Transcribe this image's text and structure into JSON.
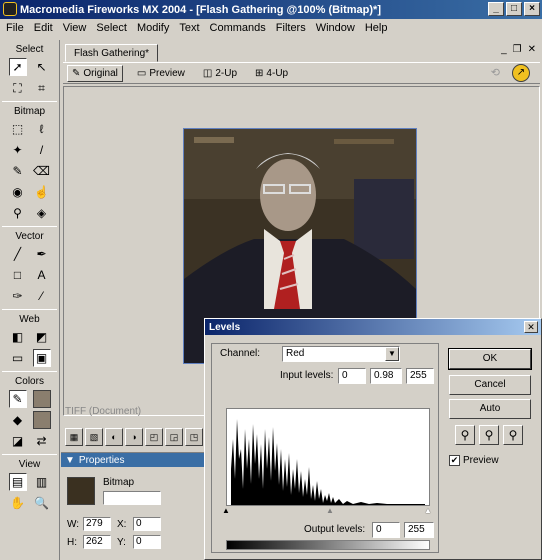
{
  "window": {
    "title": "Macromedia Fireworks MX 2004 - [Flash Gathering @100% (Bitmap)*]",
    "min": "_",
    "max": "□",
    "close": "×"
  },
  "menu": [
    "File",
    "Edit",
    "View",
    "Select",
    "Modify",
    "Text",
    "Commands",
    "Filters",
    "Window",
    "Help"
  ],
  "toolbox": {
    "select": "Select",
    "bitmap": "Bitmap",
    "vector": "Vector",
    "web": "Web",
    "colors": "Colors",
    "view": "View"
  },
  "document": {
    "tab": "Flash Gathering*",
    "views": [
      "Original",
      "Preview",
      "2-Up",
      "4-Up"
    ],
    "status": "TIFF (Document)"
  },
  "properties": {
    "header": "Properties",
    "type": "Bitmap",
    "w_label": "W:",
    "w": "279",
    "h_label": "H:",
    "h": "262",
    "x_label": "X:",
    "x": "0",
    "y_label": "Y:",
    "y": "0"
  },
  "levels": {
    "title": "Levels",
    "channel_label": "Channel:",
    "channel": "Red",
    "input_label": "Input levels:",
    "input": [
      "0",
      "0.98",
      "255"
    ],
    "output_label": "Output levels:",
    "output": [
      "0",
      "255"
    ],
    "buttons": {
      "ok": "OK",
      "cancel": "Cancel",
      "auto": "Auto"
    },
    "preview_label": "Preview",
    "preview_checked": true
  },
  "colors": {
    "accent": "#0a246a",
    "selection": "#6080c0"
  }
}
